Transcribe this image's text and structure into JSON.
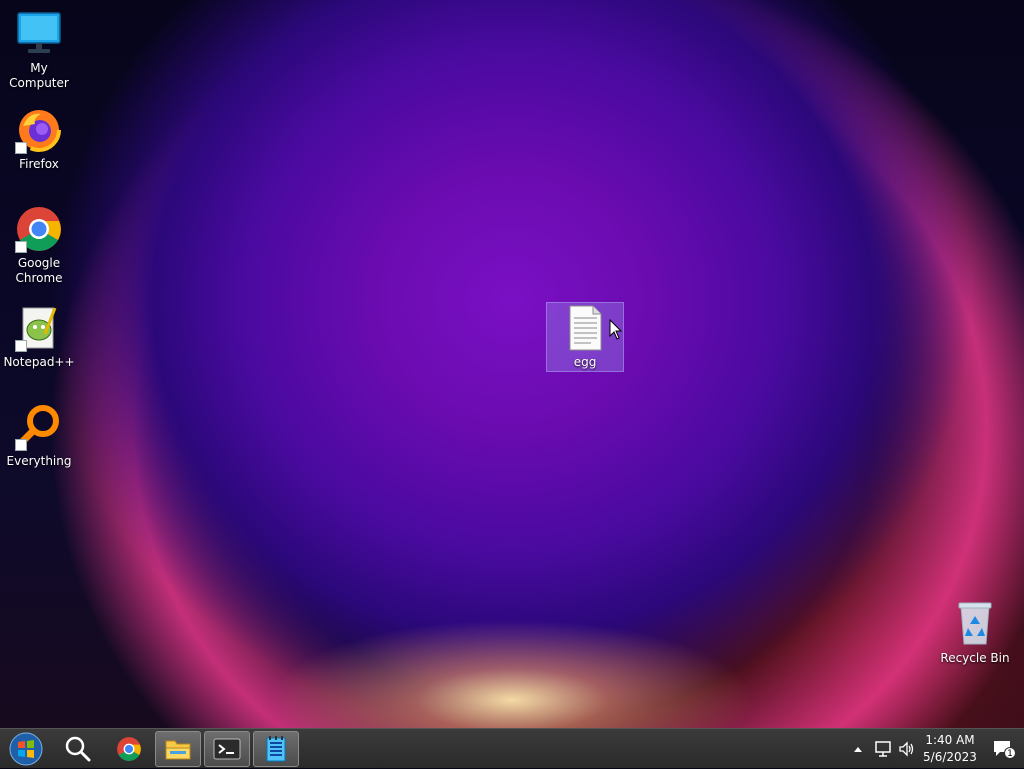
{
  "desktop": {
    "icons": [
      {
        "label": "My Computer",
        "icon": "monitor-icon"
      },
      {
        "label": "Firefox",
        "icon": "firefox-icon"
      },
      {
        "label": "Google Chrome",
        "icon": "chrome-icon"
      },
      {
        "label": "Notepad++",
        "icon": "notepadpp-icon"
      },
      {
        "label": "Everything",
        "icon": "everything-icon"
      },
      {
        "label": "egg",
        "icon": "text-file-icon"
      },
      {
        "label": "Recycle Bin",
        "icon": "recycle-bin-icon"
      }
    ]
  },
  "taskbar": {
    "buttons": [
      {
        "icon": "windows-start-icon"
      },
      {
        "icon": "search-icon"
      },
      {
        "icon": "chrome-icon"
      },
      {
        "icon": "file-explorer-icon"
      },
      {
        "icon": "terminal-icon"
      },
      {
        "icon": "notepad-icon"
      }
    ],
    "tray": {
      "icons": [
        "show-hidden-icons-chevron",
        "network-icon",
        "volume-icon"
      ],
      "time": "1:40 AM",
      "date": "5/6/2023",
      "notification_count": "1"
    }
  }
}
